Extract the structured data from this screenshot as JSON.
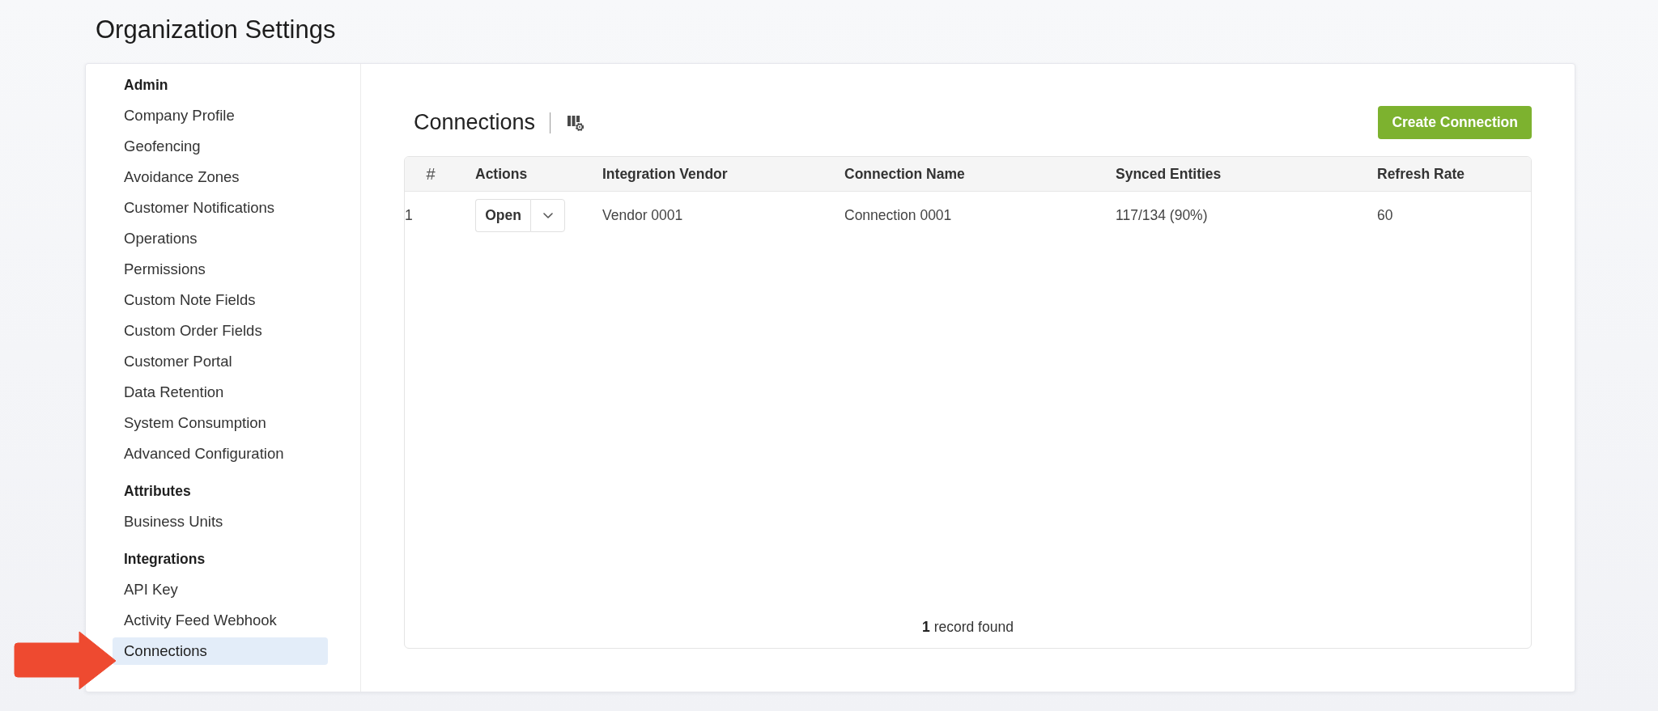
{
  "page": {
    "title": "Organization Settings"
  },
  "sidebar": {
    "sections": [
      {
        "heading": "Admin",
        "items": [
          {
            "label": "Company Profile",
            "selected": false
          },
          {
            "label": "Geofencing",
            "selected": false
          },
          {
            "label": "Avoidance Zones",
            "selected": false
          },
          {
            "label": "Customer Notifications",
            "selected": false
          },
          {
            "label": "Operations",
            "selected": false
          },
          {
            "label": "Permissions",
            "selected": false
          },
          {
            "label": "Custom Note Fields",
            "selected": false
          },
          {
            "label": "Custom Order Fields",
            "selected": false
          },
          {
            "label": "Customer Portal",
            "selected": false
          },
          {
            "label": "Data Retention",
            "selected": false
          },
          {
            "label": "System Consumption",
            "selected": false
          },
          {
            "label": "Advanced Configuration",
            "selected": false
          }
        ]
      },
      {
        "heading": "Attributes",
        "items": [
          {
            "label": "Business Units",
            "selected": false
          }
        ]
      },
      {
        "heading": "Integrations",
        "items": [
          {
            "label": "API Key",
            "selected": false
          },
          {
            "label": "Activity Feed Webhook",
            "selected": false
          },
          {
            "label": "Connections",
            "selected": true
          }
        ]
      }
    ]
  },
  "content": {
    "title": "Connections",
    "create_button": "Create Connection"
  },
  "table": {
    "columns": [
      "#",
      "Actions",
      "Integration Vendor",
      "Connection Name",
      "Synced Entities",
      "Refresh Rate"
    ],
    "rows": [
      {
        "cells": [
          {
            "kind": "number",
            "text": "1"
          },
          {
            "kind": "split_button",
            "text": "Open"
          },
          {
            "kind": "text",
            "text": "Vendor 0001"
          },
          {
            "kind": "text",
            "text": "Connection 0001"
          },
          {
            "kind": "text",
            "text": "117/134 (90%)"
          },
          {
            "kind": "text",
            "text": "60"
          }
        ]
      }
    ],
    "footer": "**1** record found"
  }
}
